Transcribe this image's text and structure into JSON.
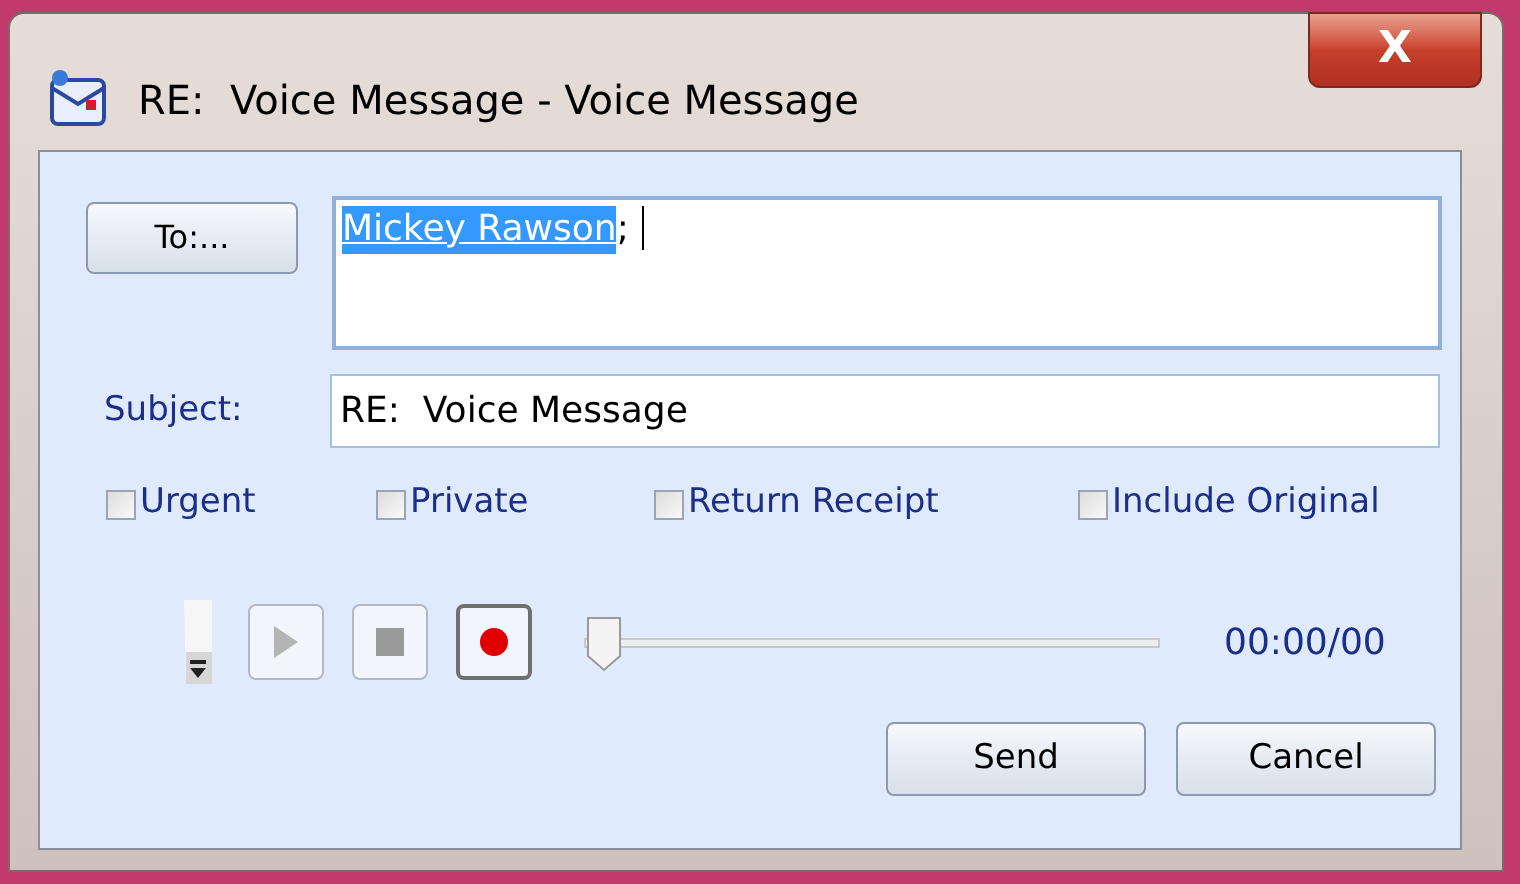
{
  "window": {
    "title": "RE:  Voice Message - Voice Message",
    "close": "X"
  },
  "to_button": "To:...",
  "to_field": {
    "recipient": "Mickey Rawson",
    "separator": "; "
  },
  "subject": {
    "label": "Subject:",
    "value": "RE:  Voice Message"
  },
  "options": [
    {
      "label": "Urgent",
      "checked": false
    },
    {
      "label": "Private",
      "checked": false
    },
    {
      "label": "Return Receipt",
      "checked": false
    },
    {
      "label": "Include Original",
      "checked": false
    }
  ],
  "player": {
    "controls": [
      {
        "kind": "play",
        "disabled": true
      },
      {
        "kind": "stop",
        "disabled": true
      },
      {
        "kind": "record",
        "disabled": false
      }
    ],
    "position": {
      "level": 0
    },
    "time": "00:00/00"
  },
  "buttons": [
    "Send",
    "Cancel"
  ]
}
